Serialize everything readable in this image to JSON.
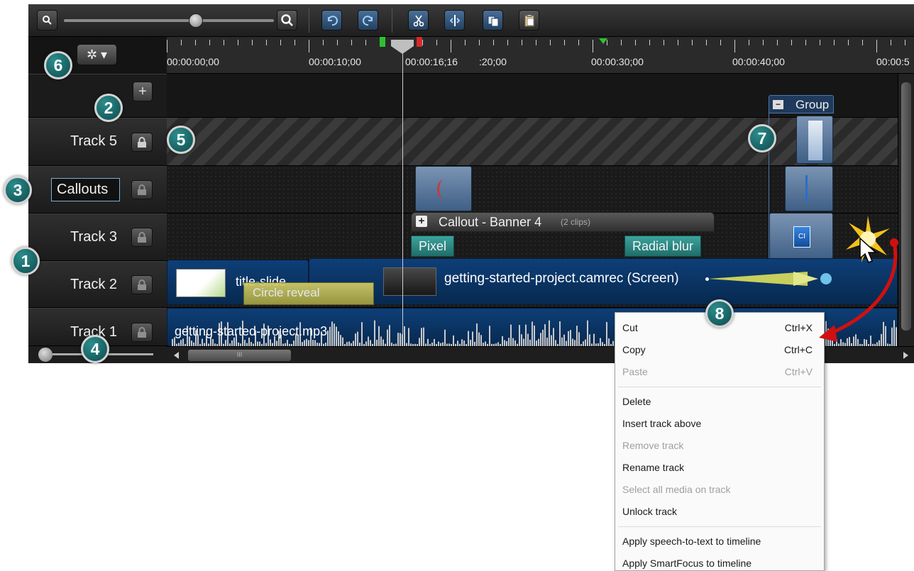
{
  "toolbar": {
    "zoom_out_icon": "zoom-out-magnifier",
    "zoom_in_icon": "zoom-in-magnifier",
    "undo_icon": "undo-arrow",
    "redo_icon": "redo-arrow",
    "cut_icon": "scissors",
    "split_icon": "split-bars",
    "copy_icon": "copy-pages",
    "paste_icon": "clipboard"
  },
  "timeline": {
    "zoom_level": 0.63,
    "ruler_labels": [
      "00:00:00;00",
      "00:00:10;00",
      "00:00:16;16",
      ":20;00",
      "00:00:30;00",
      "00:00:40;00",
      "00:00:5"
    ],
    "add_track_glyph": "+",
    "options_glyph": "✲ ▾"
  },
  "tracks": [
    {
      "name": "Track 5"
    },
    {
      "name": "Callouts"
    },
    {
      "name": "Track 3"
    },
    {
      "name": "Track 2"
    },
    {
      "name": "Track 1"
    }
  ],
  "clips": {
    "group_label": "Group",
    "group_collapse": "−",
    "callout_expand": "+",
    "callout_title": "Callout - Banner 4",
    "callout_count": "(2 clips)",
    "effect_left": "Pixel",
    "effect_right": "Radial blur",
    "title_clip": "title-slide",
    "title_effect": "Circle reveal",
    "screen_clip": "getting-started-project.camrec (Screen)",
    "audio_clip": "getting-started-project.mp3",
    "screen_icon_label": "CI"
  },
  "scrollbar": {
    "grip": "III"
  },
  "context_menu": {
    "items": [
      {
        "label": "Cut",
        "shortcut": "Ctrl+X"
      },
      {
        "label": "Copy",
        "shortcut": "Ctrl+C"
      },
      {
        "label": "Paste",
        "shortcut": "Ctrl+V"
      },
      {
        "label": "Delete"
      },
      {
        "label": "Insert track above"
      },
      {
        "label": "Remove track"
      },
      {
        "label": "Rename track"
      },
      {
        "label": "Select all media on track"
      },
      {
        "label": "Unlock track"
      },
      {
        "label": "Apply speech-to-text to timeline"
      },
      {
        "label": "Apply SmartFocus to timeline"
      }
    ]
  },
  "badges": [
    "1",
    "2",
    "3",
    "4",
    "5",
    "6",
    "7",
    "8"
  ],
  "colors": {
    "badge": "#1b6a6c",
    "clip_blue": "#0e3f78",
    "effect_teal": "#3da39d",
    "title_effect": "#b9b24a",
    "arrow_red": "#d01010"
  }
}
